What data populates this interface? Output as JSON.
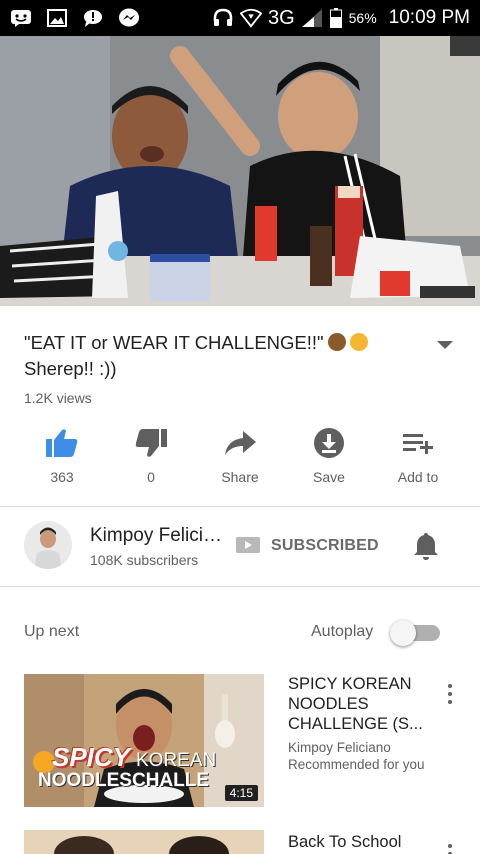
{
  "statusbar": {
    "network": "3G",
    "battery": "56%",
    "time": "10:09 PM",
    "icons": [
      "messenger-face-icon",
      "image-icon",
      "chat-alert-icon",
      "messenger-bolt-icon",
      "headset-icon",
      "wifi-download-icon",
      "signal-icon",
      "battery-icon"
    ]
  },
  "video": {
    "title": "\"EAT IT or WEAR IT CHALLENGE!!\"",
    "title_line2": "Sherep!! :))",
    "title_emojis": [
      "see-no-evil-monkey-emoji",
      "laughing-emoji"
    ],
    "views": "1.2K views"
  },
  "actions": [
    {
      "icon": "thumbs-up-icon",
      "label": "363",
      "active": true
    },
    {
      "icon": "thumbs-down-icon",
      "label": "0"
    },
    {
      "icon": "share-icon",
      "label": "Share"
    },
    {
      "icon": "download-icon",
      "label": "Save"
    },
    {
      "icon": "playlist-add-icon",
      "label": "Add to"
    }
  ],
  "channel": {
    "name": "Kimpoy Feliciano",
    "subscribers": "108K subscribers",
    "subscribe_label": "SUBSCRIBED"
  },
  "upnext": {
    "label": "Up next",
    "autoplay_label": "Autoplay",
    "autoplay_on": false,
    "items": [
      {
        "title": "SPICY KOREAN NOODLES CHALLENGE (S...",
        "channel": "Kimpoy Feliciano",
        "reason": "Recommended for you",
        "duration": "4:15",
        "thumb_text_1": "SPICY",
        "thumb_text_2": "KOREAN",
        "thumb_text_3": "NOODLESCHALLE"
      },
      {
        "title": "Back To School"
      }
    ]
  },
  "colors": {
    "accent": "#3e8ee8",
    "text_primary": "#212121",
    "text_secondary": "#606060",
    "icon_grey": "#5f5f5f"
  }
}
